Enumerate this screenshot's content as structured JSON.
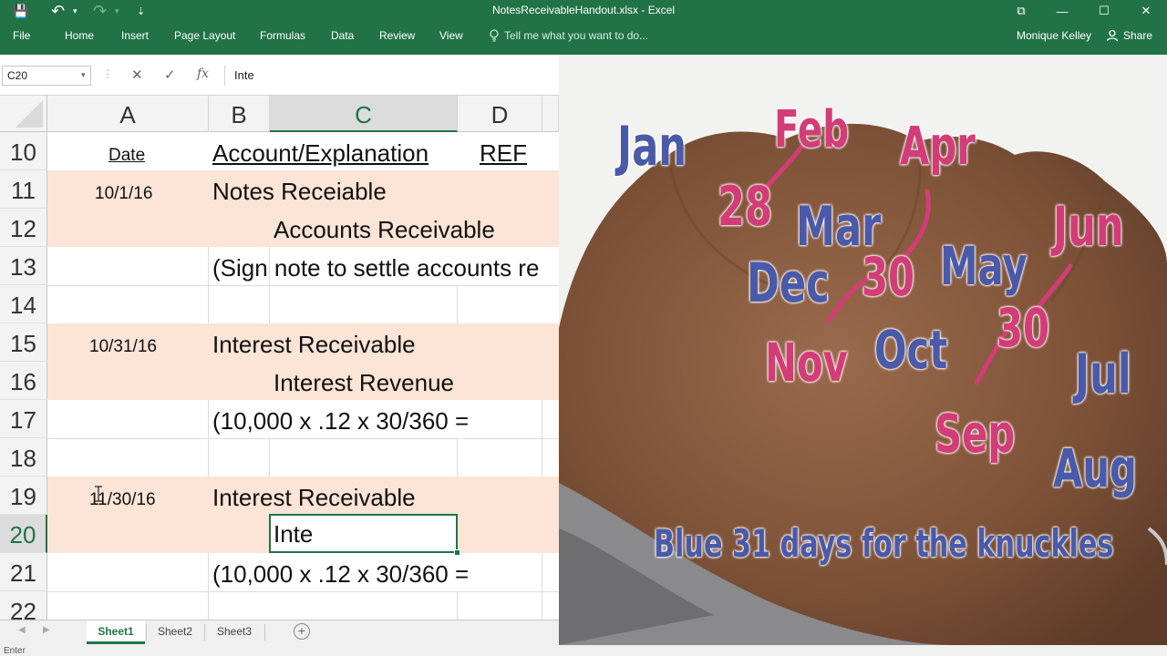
{
  "window": {
    "title": "NotesReceivableHandout.xlsx - Excel",
    "quick_access": {
      "save": "💾",
      "undo": "↶",
      "undo_arrow": "▾",
      "redo": "↷",
      "redo_arrow": "▾",
      "customize": "⇣"
    },
    "controls": {
      "restore_ribbon": "⧉",
      "minimize": "—",
      "maximize": "☐",
      "close": "✕"
    }
  },
  "ribbon": {
    "tabs": [
      "File",
      "Home",
      "Insert",
      "Page Layout",
      "Formulas",
      "Data",
      "Review",
      "View"
    ],
    "tell_me": "Tell me what you want to do...",
    "user": "Monique Kelley",
    "share": "Share"
  },
  "formula_bar": {
    "name_box": "C20",
    "name_box_arrow": "▾",
    "separator": "⋮",
    "cancel": "✕",
    "enter": "✓",
    "fx": "fx",
    "value": "Inte"
  },
  "columns": [
    "A",
    "B",
    "C",
    "D"
  ],
  "rows": [
    "10",
    "11",
    "12",
    "13",
    "14",
    "15",
    "16",
    "17",
    "18",
    "19",
    "20",
    "21",
    "22"
  ],
  "cells": {
    "a10": "Date",
    "b10": "Account/Explanation",
    "d10": "REF",
    "a11": "10/1/16",
    "b11": "Notes Receiable",
    "c12": "Accounts Receivable",
    "b13": "(Sign note to settle accounts re",
    "a15": "10/31/16",
    "b15": "Interest Receivable",
    "c16": "Interest Revenue",
    "b17": "(10,000 x .12 x 30/360 =",
    "a19": "11/30/16",
    "b19": "Interest Receivable",
    "c20": "Inte",
    "b21": "(10,000 x .12 x 30/360 ="
  },
  "sheets": [
    "Sheet1",
    "Sheet2",
    "Sheet3"
  ],
  "active_sheet": "Sheet1",
  "tab_nav": {
    "prev": "◀",
    "next": "▶",
    "add": "+"
  },
  "status": "Enter",
  "photo": {
    "months": {
      "jan": "Jan",
      "feb": "Feb",
      "mar": "Mar",
      "apr": "Apr",
      "may": "May",
      "jun": "Jun",
      "jul": "Jul",
      "aug": "Aug",
      "sep": "Sep",
      "oct": "Oct",
      "nov": "Nov",
      "dec": "Dec"
    },
    "days": {
      "feb_days": "28",
      "apr_days": "30",
      "jun_days": "30"
    },
    "caption": "Blue 31 days for the knuckles",
    "colors": {
      "long_month": "#4a5aa8",
      "short_month": "#d23d78",
      "skin": "#8a5a3e"
    }
  }
}
